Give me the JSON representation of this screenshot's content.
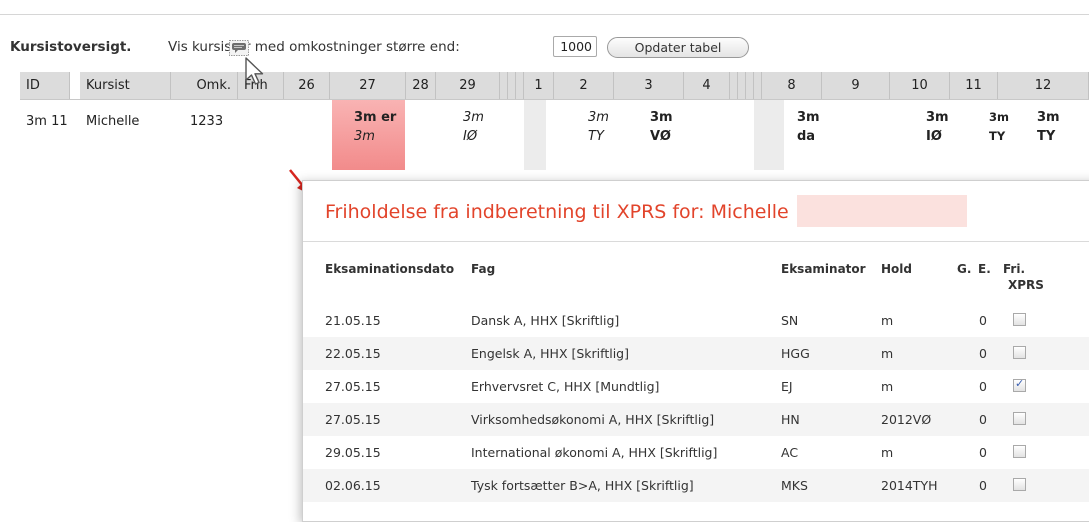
{
  "header": {
    "title": "Kursistoversigt.",
    "filter_text": "Vis kursister med omkostninger større end:",
    "threshold_value": "1000",
    "update_button": "Opdater tabel"
  },
  "table": {
    "columns": {
      "id": "ID",
      "kursist": "Kursist",
      "omk": "Omk.",
      "frih": "Frih",
      "d26": "26",
      "d27": "27",
      "d28": "28",
      "d29": "29",
      "d1": "1",
      "d2": "2",
      "d3": "3",
      "d4": "4",
      "d8": "8",
      "d9": "9",
      "d10": "10",
      "d11": "11",
      "d12": "12"
    },
    "row": {
      "id": "3m 11",
      "name": "Michelle",
      "omk": "1233",
      "d27": {
        "line1": "3m er",
        "line2": "3m"
      },
      "d29": {
        "line1": "3m",
        "line2": "IØ"
      },
      "d2": {
        "line1": "3m",
        "line2": "TY"
      },
      "d3": {
        "line1": "3m",
        "line2": "VØ"
      },
      "d8": {
        "line1": "3m",
        "line2": "da"
      },
      "d10": {
        "line1": "3m",
        "line2": "IØ"
      },
      "d11": {
        "line1": "3m",
        "line2": "TY"
      },
      "d12": {
        "line1": "3m",
        "line2": "TY"
      }
    }
  },
  "popup": {
    "title": "Friholdelse fra indberetning til XPRS for: Michelle",
    "headers": {
      "date": "Eksaminationsdato",
      "fag": "Fag",
      "eksaminator": "Eksaminator",
      "hold": "Hold",
      "g": "G.",
      "e": "E.",
      "fri_1": "Fri.",
      "fri_2": "XPRS"
    },
    "rows": [
      {
        "date": "21.05.15",
        "fag": "Dansk A, HHX [Skriftlig]",
        "eksaminator": "SN",
        "hold": "m",
        "e": "0",
        "checked": false
      },
      {
        "date": "22.05.15",
        "fag": "Engelsk A, HHX [Skriftlig]",
        "eksaminator": "HGG",
        "hold": "m",
        "e": "0",
        "checked": false
      },
      {
        "date": "27.05.15",
        "fag": "Erhvervsret C, HHX [Mundtlig]",
        "eksaminator": "EJ",
        "hold": "m",
        "e": "0",
        "checked": true
      },
      {
        "date": "27.05.15",
        "fag": "Virksomhedsøkonomi A, HHX [Skriftlig]",
        "eksaminator": "HN",
        "hold": "2012VØ",
        "e": "0",
        "checked": false
      },
      {
        "date": "29.05.15",
        "fag": "International økonomi A, HHX [Skriftlig]",
        "eksaminator": "AC",
        "hold": "m",
        "e": "0",
        "checked": false
      },
      {
        "date": "02.06.15",
        "fag": "Tysk fortsætter B>A, HHX [Skriftlig]",
        "eksaminator": "MKS",
        "hold": "2014TYH",
        "e": "0",
        "checked": false
      }
    ]
  },
  "icons": {
    "chat": "speech-bubble-icon",
    "cursor": "mouse-pointer-icon",
    "arrow": "red-arrow-icon"
  },
  "colors": {
    "accent_red": "#e2442b",
    "highlight_cell": "#f59a9a",
    "header_gray": "#dcdcdc"
  }
}
